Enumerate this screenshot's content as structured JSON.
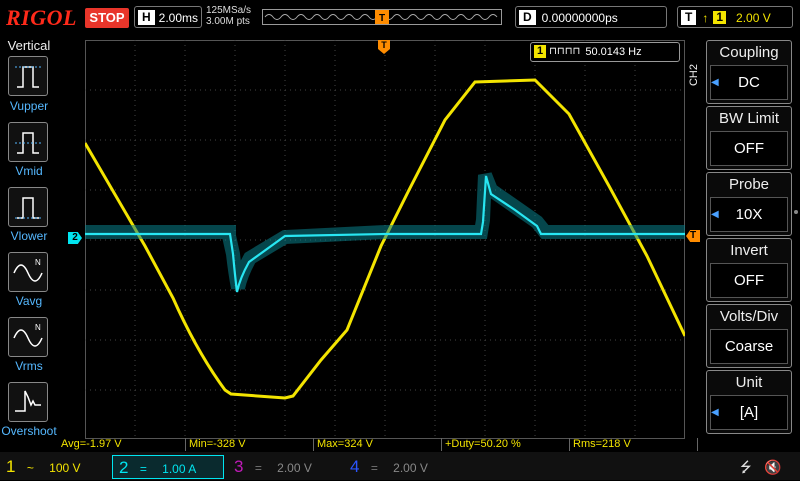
{
  "brand": "RIGOL",
  "run_state": "STOP",
  "horizontal": {
    "key": "H",
    "timebase": "2.00ms",
    "sample_rate": "125MSa/s",
    "mem_depth": "3.00M pts"
  },
  "delay": {
    "key": "D",
    "value": "0.00000000ps"
  },
  "trigger": {
    "key": "T",
    "source": "1",
    "level": "2.00 V"
  },
  "frequency_counter": {
    "channel": "1",
    "value": "50.0143 Hz"
  },
  "channel_tab": "CH2",
  "left_menu": {
    "title": "Vertical",
    "items": [
      "Vupper",
      "Vmid",
      "Vlower",
      "Vavg",
      "Vrms",
      "Overshoot"
    ]
  },
  "right_menu": [
    {
      "title": "Coupling",
      "value": "DC"
    },
    {
      "title": "BW Limit",
      "value": "OFF"
    },
    {
      "title": "Probe",
      "value": "10X"
    },
    {
      "title": "Invert",
      "value": "OFF"
    },
    {
      "title": "Volts/Div",
      "value": "Coarse"
    },
    {
      "title": "Unit",
      "value": "[A]"
    }
  ],
  "measurements": {
    "avg": "Avg=-1.97 V",
    "min": "Min=-328 V",
    "max": "Max=324 V",
    "duty": "+Duty=50.20 %",
    "rms": "Rms=218 V"
  },
  "channels": [
    {
      "num": "1",
      "coupling": "~",
      "scale": "100 V",
      "color": "#f3e400",
      "active": false
    },
    {
      "num": "2",
      "coupling": "=",
      "scale": "1.00 A",
      "color": "#00e5f0",
      "active": true
    },
    {
      "num": "3",
      "coupling": "=",
      "scale": "2.00 V",
      "color": "#c01ab8",
      "active": false
    },
    {
      "num": "4",
      "coupling": "=",
      "scale": "2.00 V",
      "color": "#2b55ff",
      "active": false
    }
  ],
  "markers": {
    "ch2_ground": "2",
    "trigger_level": "T"
  },
  "colors": {
    "ch1": "#f3e400",
    "ch2": "#00e5f0",
    "trigger": "#ff8c00",
    "accent": "#55b8ff",
    "stop": "#e8352a"
  }
}
